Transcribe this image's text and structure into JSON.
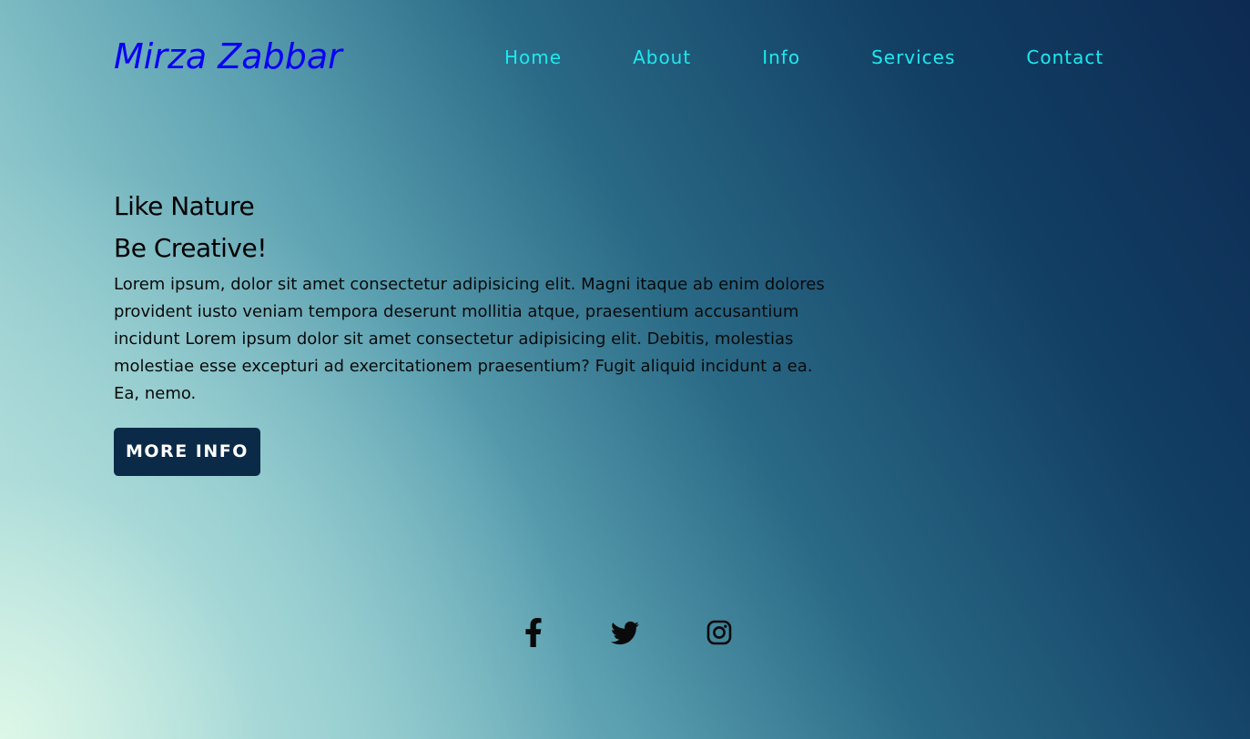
{
  "brand": {
    "name": "Mirza Zabbar",
    "color": "#0a00f5"
  },
  "nav": {
    "color": "#1de9ef",
    "items": [
      {
        "label": "Home"
      },
      {
        "label": "About"
      },
      {
        "label": "Info"
      },
      {
        "label": "Services"
      },
      {
        "label": "Contact"
      }
    ]
  },
  "hero": {
    "title_line1": "Like Nature",
    "title_line2": "Be Creative!",
    "paragraph": "Lorem ipsum, dolor sit amet consectetur adipisicing elit. Magni itaque ab enim dolores provident iusto veniam tempora deserunt mollitia atque, praesentium accusantium incidunt Lorem ipsum dolor sit amet consectetur adipisicing elit. Debitis, molestias molestiae esse excepturi ad exercitationem praesentium? Fugit aliquid incidunt a ea. Ea, nemo.",
    "button_label": "MORE INFO",
    "button_color": "#0b2a47"
  },
  "social": {
    "icons": [
      "facebook-icon",
      "twitter-icon",
      "instagram-icon"
    ]
  }
}
